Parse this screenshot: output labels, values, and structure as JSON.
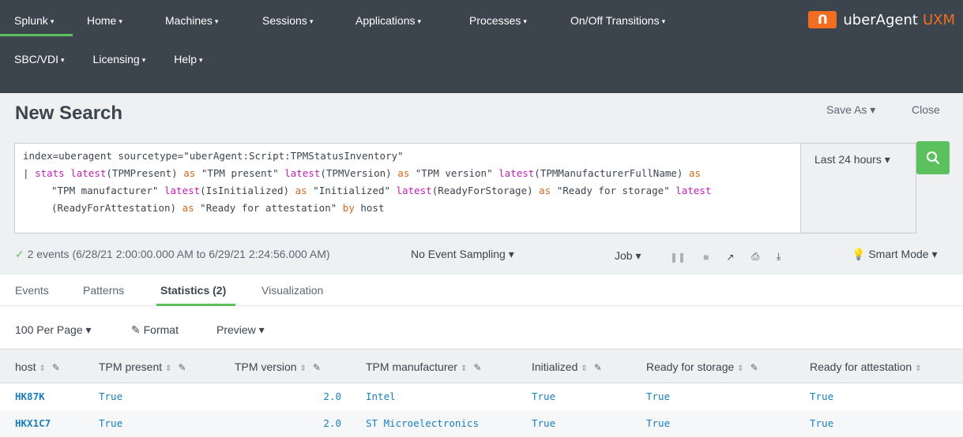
{
  "nav": {
    "row1": [
      "Splunk",
      "Home",
      "Machines",
      "Sessions",
      "Applications",
      "Processes",
      "On/Off Transitions"
    ],
    "row2": [
      "SBC/VDI",
      "Licensing",
      "Help"
    ],
    "caret": "▾",
    "brand_logo": "ꓵ",
    "brand_name": "uberAgent",
    "brand_accent": "UXM"
  },
  "page": {
    "title": "New Search",
    "save_as": "Save As ▾",
    "close": "Close"
  },
  "search": {
    "line1": "index=uberagent sourcetype=\"uberAgent:Script:TPMStatusInventory\"",
    "line2": [
      {
        "t": "| ",
        "c": "str"
      },
      {
        "t": "stats",
        "c": "kw"
      },
      {
        "t": " ",
        "c": "str"
      },
      {
        "t": "latest",
        "c": "kw"
      },
      {
        "t": "(TPMPresent) ",
        "c": "str"
      },
      {
        "t": "as",
        "c": "kw2"
      },
      {
        "t": " \"TPM present\" ",
        "c": "str"
      },
      {
        "t": "latest",
        "c": "kw"
      },
      {
        "t": "(TPMVersion) ",
        "c": "str"
      },
      {
        "t": "as",
        "c": "kw2"
      },
      {
        "t": " \"TPM version\" ",
        "c": "str"
      },
      {
        "t": "latest",
        "c": "kw"
      },
      {
        "t": "(TPMManufacturerFullName) ",
        "c": "str"
      },
      {
        "t": "as",
        "c": "kw2"
      }
    ],
    "line3": [
      {
        "t": "\"TPM manufacturer\" ",
        "c": "str"
      },
      {
        "t": "latest",
        "c": "kw"
      },
      {
        "t": "(IsInitialized) ",
        "c": "str"
      },
      {
        "t": "as",
        "c": "kw2"
      },
      {
        "t": " \"Initialized\" ",
        "c": "str"
      },
      {
        "t": "latest",
        "c": "kw"
      },
      {
        "t": "(ReadyForStorage) ",
        "c": "str"
      },
      {
        "t": "as",
        "c": "kw2"
      },
      {
        "t": " \"Ready for storage\" ",
        "c": "str"
      },
      {
        "t": "latest",
        "c": "kw"
      }
    ],
    "line4": [
      {
        "t": "(ReadyForAttestation) ",
        "c": "str"
      },
      {
        "t": "as",
        "c": "kw2"
      },
      {
        "t": " \"Ready for attestation\"  ",
        "c": "str"
      },
      {
        "t": "by",
        "c": "kw2"
      },
      {
        "t": " host",
        "c": "str"
      }
    ],
    "time_range": "Last 24 hours ▾"
  },
  "status": {
    "check": "✓",
    "events_text": "2 events (6/28/21 2:00:00.000 AM to 6/29/21 2:24:56.000 AM)",
    "sampling": "No Event Sampling ▾",
    "job": "Job ▾",
    "smart_mode": "Smart Mode ▾"
  },
  "tabs": [
    "Events",
    "Patterns",
    "Statistics (2)",
    "Visualization"
  ],
  "toolbar": {
    "per_page": "100 Per Page ▾",
    "format": "Format",
    "preview": "Preview ▾"
  },
  "table": {
    "columns": [
      "host",
      "TPM present",
      "TPM version",
      "TPM manufacturer",
      "Initialized",
      "Ready for storage",
      "Ready for attestation"
    ],
    "rows": [
      [
        "HK87K",
        "True",
        "2.0",
        "Intel",
        "True",
        "True",
        "True"
      ],
      [
        "HKX1C7",
        "True",
        "2.0",
        "ST Microelectronics",
        "True",
        "True",
        "True"
      ]
    ]
  }
}
